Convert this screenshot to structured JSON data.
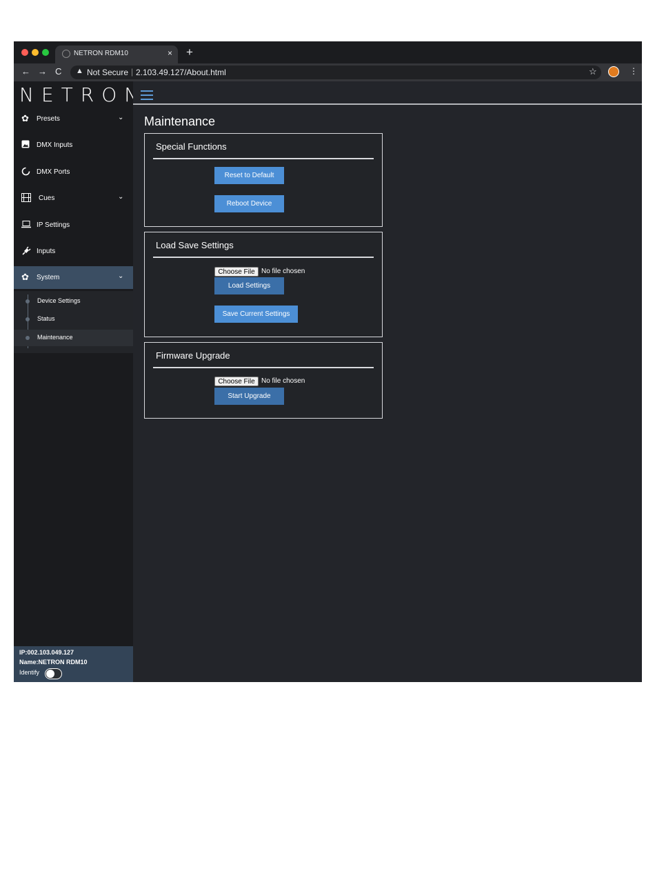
{
  "browser": {
    "tab_title": "NETRON RDM10",
    "tab_close": "×",
    "new_tab": "+",
    "security_label": "Not Secure",
    "url": "2.103.49.127/About.html",
    "back": "←",
    "forward": "→",
    "reload": "C",
    "star": "☆",
    "menu": "⋮"
  },
  "app": {
    "logo": "NETRON"
  },
  "sidebar": {
    "items": [
      {
        "label": "Presets",
        "icon": "gear-icon",
        "has_chevron": true
      },
      {
        "label": "DMX Inputs",
        "icon": "image-icon",
        "has_chevron": false
      },
      {
        "label": "DMX Ports",
        "icon": "circle-icon",
        "has_chevron": false
      },
      {
        "label": "Cues",
        "icon": "film-icon",
        "has_chevron": true
      },
      {
        "label": "IP Settings",
        "icon": "laptop-icon",
        "has_chevron": false
      },
      {
        "label": "Inputs",
        "icon": "plug-icon",
        "has_chevron": false
      },
      {
        "label": "System",
        "icon": "gear-icon",
        "has_chevron": true,
        "active": true
      }
    ],
    "submenu": [
      {
        "label": "Device Settings"
      },
      {
        "label": "Status"
      },
      {
        "label": "Maintenance",
        "active": true
      }
    ],
    "footer": {
      "ip": "IP:002.103.049.127",
      "name": "Name:NETRON RDM10",
      "identify_label": "Identify",
      "identify_on": false
    }
  },
  "main": {
    "title": "Maintenance",
    "special": {
      "title": "Special Functions",
      "reset_label": "Reset to Default",
      "reboot_label": "Reboot Device"
    },
    "loadsave": {
      "title": "Load Save Settings",
      "choose_label": "Choose File",
      "no_file": "No file chosen",
      "load_label": "Load Settings",
      "save_label": "Save Current Settings"
    },
    "firmware": {
      "title": "Firmware Upgrade",
      "choose_label": "Choose File",
      "no_file": "No file chosen",
      "start_label": "Start Upgrade"
    }
  },
  "colors": {
    "accent": "#4c8fd6",
    "sidebar_active": "#3b4e63",
    "background": "#23252a"
  }
}
